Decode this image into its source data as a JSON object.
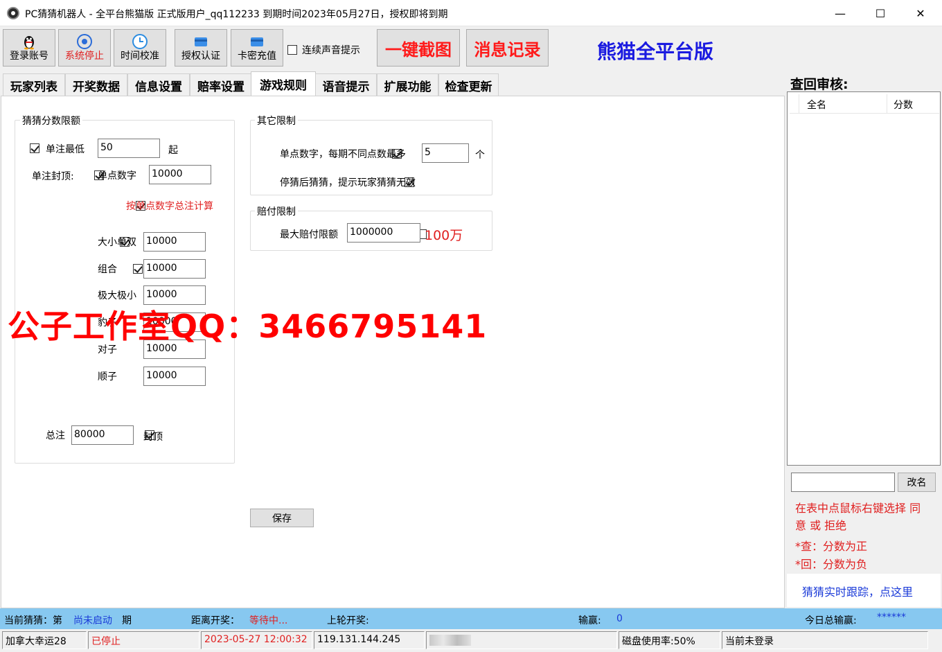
{
  "window": {
    "title": "PC猜猜机器人 - 全平台熊猫版 正式版用户_qq112233 到期时间2023年05月27日，授权即将到期",
    "minimize": "—",
    "maximize": "☐",
    "close": "✕"
  },
  "toolbar": {
    "login": "登录账号",
    "system_stop": "系统停止",
    "time_sync": "时间校准",
    "auth": "授权认证",
    "recharge": "卡密充值",
    "sound_label": "连续声音提示",
    "screenshot": "一键截图",
    "messages": "消息记录",
    "edition": "熊猫全平台版"
  },
  "tabs": [
    "玩家列表",
    "开奖数据",
    "信息设置",
    "赔率设置",
    "游戏规则",
    "语音提示",
    "扩展功能",
    "检查更新"
  ],
  "limits": {
    "title": "猜猜分数限额",
    "single_min_label": "单注最低",
    "single_min_value": "50",
    "single_min_suffix": "起",
    "cap_label": "单注封顶:",
    "single_num_label": "单点数字",
    "single_num_value": "10000",
    "by_single_label": "按单点数字总注计算",
    "rows": [
      {
        "label": "大小单双",
        "value": "10000",
        "checked": true
      },
      {
        "label": "组合",
        "value": "10000",
        "checked": true
      },
      {
        "label": "极大极小",
        "value": "10000",
        "checked": true
      },
      {
        "label": "豹子",
        "value": "10000",
        "checked": false
      },
      {
        "label": "对子",
        "value": "10000",
        "checked": false
      },
      {
        "label": "顺子",
        "value": "10000",
        "checked": false
      }
    ],
    "total_label": "总注",
    "total_value": "80000",
    "total_suffix": "封顶"
  },
  "other": {
    "title": "其它限制",
    "single_digit_label": "单点数字，每期不同点数最多",
    "single_digit_value": "5",
    "single_digit_suffix": "个",
    "stop_label": "停猜后猜猜，提示玩家猜猜无效"
  },
  "payout": {
    "title": "赔付限制",
    "max_label": "最大赔付限额",
    "max_value": "1000000",
    "max_note": "100万"
  },
  "save_button": "保存",
  "watermark": "公子工作室QQ：3466795141",
  "review": {
    "title": "查回审核:",
    "col_name": "全名",
    "col_score": "分数",
    "rename_button": "改名",
    "hint_line1": "在表中点鼠标右键选择 同",
    "hint_line2": "意 或 拒绝",
    "rule_check": "*查：分数为正",
    "rule_return": "*回：分数为负",
    "tracking_link": "猜猜实时跟踪，点这里"
  },
  "status": {
    "current_label": "当前猜猜：第",
    "current_value": "尚未启动",
    "period": "期",
    "countdown_label": "距离开奖：",
    "countdown_value": "等待中...",
    "last_label": "上轮开奖:",
    "winloss_label": "输赢:",
    "winloss_value": "0",
    "today_label": "今日总输赢:",
    "today_value": "******"
  },
  "statusbar": {
    "game": "加拿大幸运28",
    "state": "已停止",
    "datetime": "2023-05-27 12:00:32",
    "ip": "119.131.144.245",
    "disk": "磁盘使用率:50%",
    "login": "当前未登录"
  },
  "colors": {
    "accent_red": "#ff1a1a",
    "edition_blue": "#1a1ae0",
    "status_blue": "#87c8f0",
    "link_blue": "#1a3ad8"
  }
}
